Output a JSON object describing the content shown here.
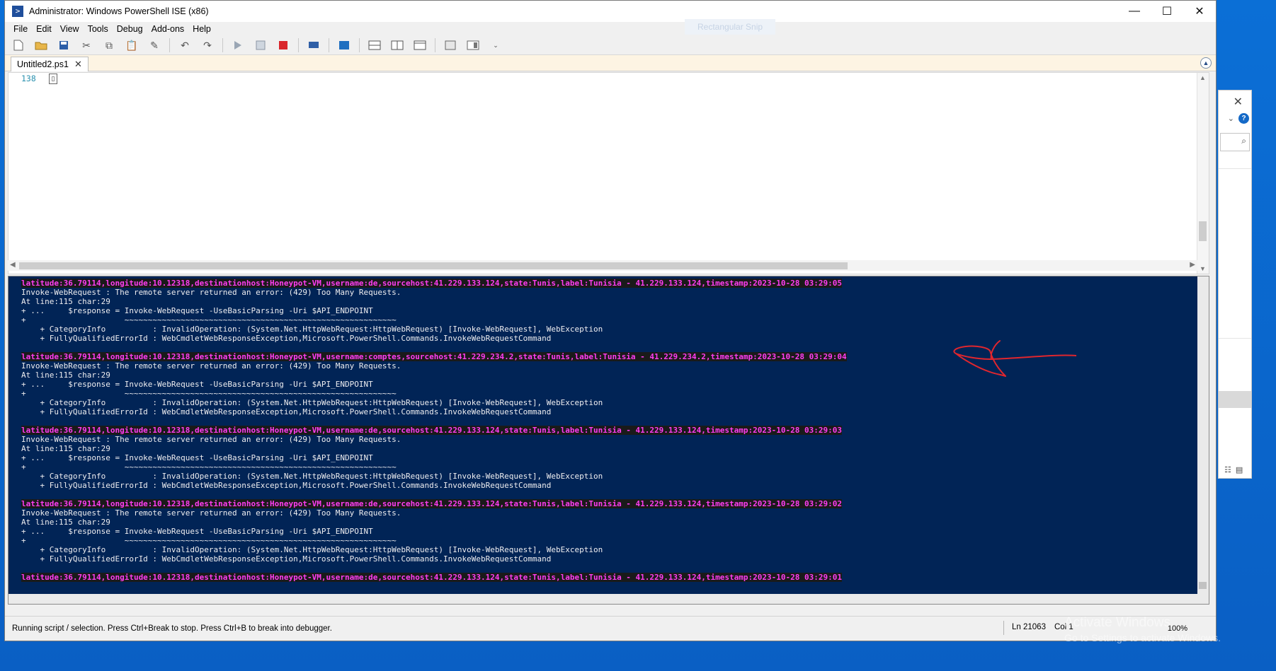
{
  "window": {
    "title": "Administrator: Windows PowerShell ISE (x86)",
    "controls": {
      "minimize": "—",
      "maximize": "☐",
      "close": "✕"
    }
  },
  "menu": [
    "File",
    "Edit",
    "View",
    "Tools",
    "Debug",
    "Add-ons",
    "Help"
  ],
  "ghost_text": "Rectangular Snip",
  "tab": {
    "label": "Untitled2.ps1",
    "close": "✕"
  },
  "editor": {
    "line_number": "138",
    "caret_glyph": "▯"
  },
  "console_lines": [
    {
      "type": "event",
      "text": "latitude:36.79114,longitude:10.12318,destinationhost:Honeypot-VM,username:de,sourcehost:41.229.133.124,state:Tunis,label:Tunisia - 41.229.133.124,timestamp:2023-10-28 03:29:05"
    },
    {
      "type": "err",
      "text": "Invoke-WebRequest : The remote server returned an error: (429) Too Many Requests."
    },
    {
      "type": "err",
      "text": "At line:115 char:29"
    },
    {
      "type": "err",
      "text": "+ ...     $response = Invoke-WebRequest -UseBasicParsing -Uri $API_ENDPOINT"
    },
    {
      "type": "err",
      "text": "+                     ~~~~~~~~~~~~~~~~~~~~~~~~~~~~~~~~~~~~~~~~~~~~~~~~~~~~~~~~~~"
    },
    {
      "type": "err",
      "text": "    + CategoryInfo          : InvalidOperation: (System.Net.HttpWebRequest:HttpWebRequest) [Invoke-WebRequest], WebException"
    },
    {
      "type": "err",
      "text": "    + FullyQualifiedErrorId : WebCmdletWebResponseException,Microsoft.PowerShell.Commands.InvokeWebRequestCommand"
    },
    {
      "type": "blank",
      "text": ""
    },
    {
      "type": "event",
      "text": "latitude:36.79114,longitude:10.12318,destinationhost:Honeypot-VM,username:comptes,sourcehost:41.229.234.2,state:Tunis,label:Tunisia - 41.229.234.2,timestamp:2023-10-28 03:29:04"
    },
    {
      "type": "err",
      "text": "Invoke-WebRequest : The remote server returned an error: (429) Too Many Requests."
    },
    {
      "type": "err",
      "text": "At line:115 char:29"
    },
    {
      "type": "err",
      "text": "+ ...     $response = Invoke-WebRequest -UseBasicParsing -Uri $API_ENDPOINT"
    },
    {
      "type": "err",
      "text": "+                     ~~~~~~~~~~~~~~~~~~~~~~~~~~~~~~~~~~~~~~~~~~~~~~~~~~~~~~~~~~"
    },
    {
      "type": "err",
      "text": "    + CategoryInfo          : InvalidOperation: (System.Net.HttpWebRequest:HttpWebRequest) [Invoke-WebRequest], WebException"
    },
    {
      "type": "err",
      "text": "    + FullyQualifiedErrorId : WebCmdletWebResponseException,Microsoft.PowerShell.Commands.InvokeWebRequestCommand"
    },
    {
      "type": "blank",
      "text": ""
    },
    {
      "type": "event",
      "text": "latitude:36.79114,longitude:10.12318,destinationhost:Honeypot-VM,username:de,sourcehost:41.229.133.124,state:Tunis,label:Tunisia - 41.229.133.124,timestamp:2023-10-28 03:29:03"
    },
    {
      "type": "err",
      "text": "Invoke-WebRequest : The remote server returned an error: (429) Too Many Requests."
    },
    {
      "type": "err",
      "text": "At line:115 char:29"
    },
    {
      "type": "err",
      "text": "+ ...     $response = Invoke-WebRequest -UseBasicParsing -Uri $API_ENDPOINT"
    },
    {
      "type": "err",
      "text": "+                     ~~~~~~~~~~~~~~~~~~~~~~~~~~~~~~~~~~~~~~~~~~~~~~~~~~~~~~~~~~"
    },
    {
      "type": "err",
      "text": "    + CategoryInfo          : InvalidOperation: (System.Net.HttpWebRequest:HttpWebRequest) [Invoke-WebRequest], WebException"
    },
    {
      "type": "err",
      "text": "    + FullyQualifiedErrorId : WebCmdletWebResponseException,Microsoft.PowerShell.Commands.InvokeWebRequestCommand"
    },
    {
      "type": "blank",
      "text": ""
    },
    {
      "type": "event",
      "text": "latitude:36.79114,longitude:10.12318,destinationhost:Honeypot-VM,username:de,sourcehost:41.229.133.124,state:Tunis,label:Tunisia - 41.229.133.124,timestamp:2023-10-28 03:29:02"
    },
    {
      "type": "err",
      "text": "Invoke-WebRequest : The remote server returned an error: (429) Too Many Requests."
    },
    {
      "type": "err",
      "text": "At line:115 char:29"
    },
    {
      "type": "err",
      "text": "+ ...     $response = Invoke-WebRequest -UseBasicParsing -Uri $API_ENDPOINT"
    },
    {
      "type": "err",
      "text": "+                     ~~~~~~~~~~~~~~~~~~~~~~~~~~~~~~~~~~~~~~~~~~~~~~~~~~~~~~~~~~"
    },
    {
      "type": "err",
      "text": "    + CategoryInfo          : InvalidOperation: (System.Net.HttpWebRequest:HttpWebRequest) [Invoke-WebRequest], WebException"
    },
    {
      "type": "err",
      "text": "    + FullyQualifiedErrorId : WebCmdletWebResponseException,Microsoft.PowerShell.Commands.InvokeWebRequestCommand"
    },
    {
      "type": "blank",
      "text": ""
    },
    {
      "type": "event",
      "text": "latitude:36.79114,longitude:10.12318,destinationhost:Honeypot-VM,username:de,sourcehost:41.229.133.124,state:Tunis,label:Tunisia - 41.229.133.124,timestamp:2023-10-28 03:29:01"
    }
  ],
  "status": {
    "message": "Running script / selection.  Press Ctrl+Break to stop.  Press Ctrl+B to break into debugger.",
    "ln": "Ln 21063",
    "col": "Col 1",
    "zoom": "100%"
  },
  "watermark": {
    "line1": "Activate Windows",
    "line2": "Go to Settings to activate Windows."
  },
  "colors": {
    "console_bg": "#012456",
    "event_text": "#ff3df2",
    "annotation": "#e0262e"
  },
  "toolbar_icons": [
    "new-icon",
    "open-icon",
    "save-icon",
    "cut-icon",
    "copy-icon",
    "paste-icon",
    "clear-icon",
    "undo-icon",
    "redo-icon",
    "run-icon",
    "run-selection-icon",
    "stop-icon",
    "remote-icon",
    "powershell-icon",
    "layout-top-icon",
    "layout-right-icon",
    "layout-max-icon",
    "show-commands-icon",
    "addon-icon",
    "overflow-icon"
  ]
}
